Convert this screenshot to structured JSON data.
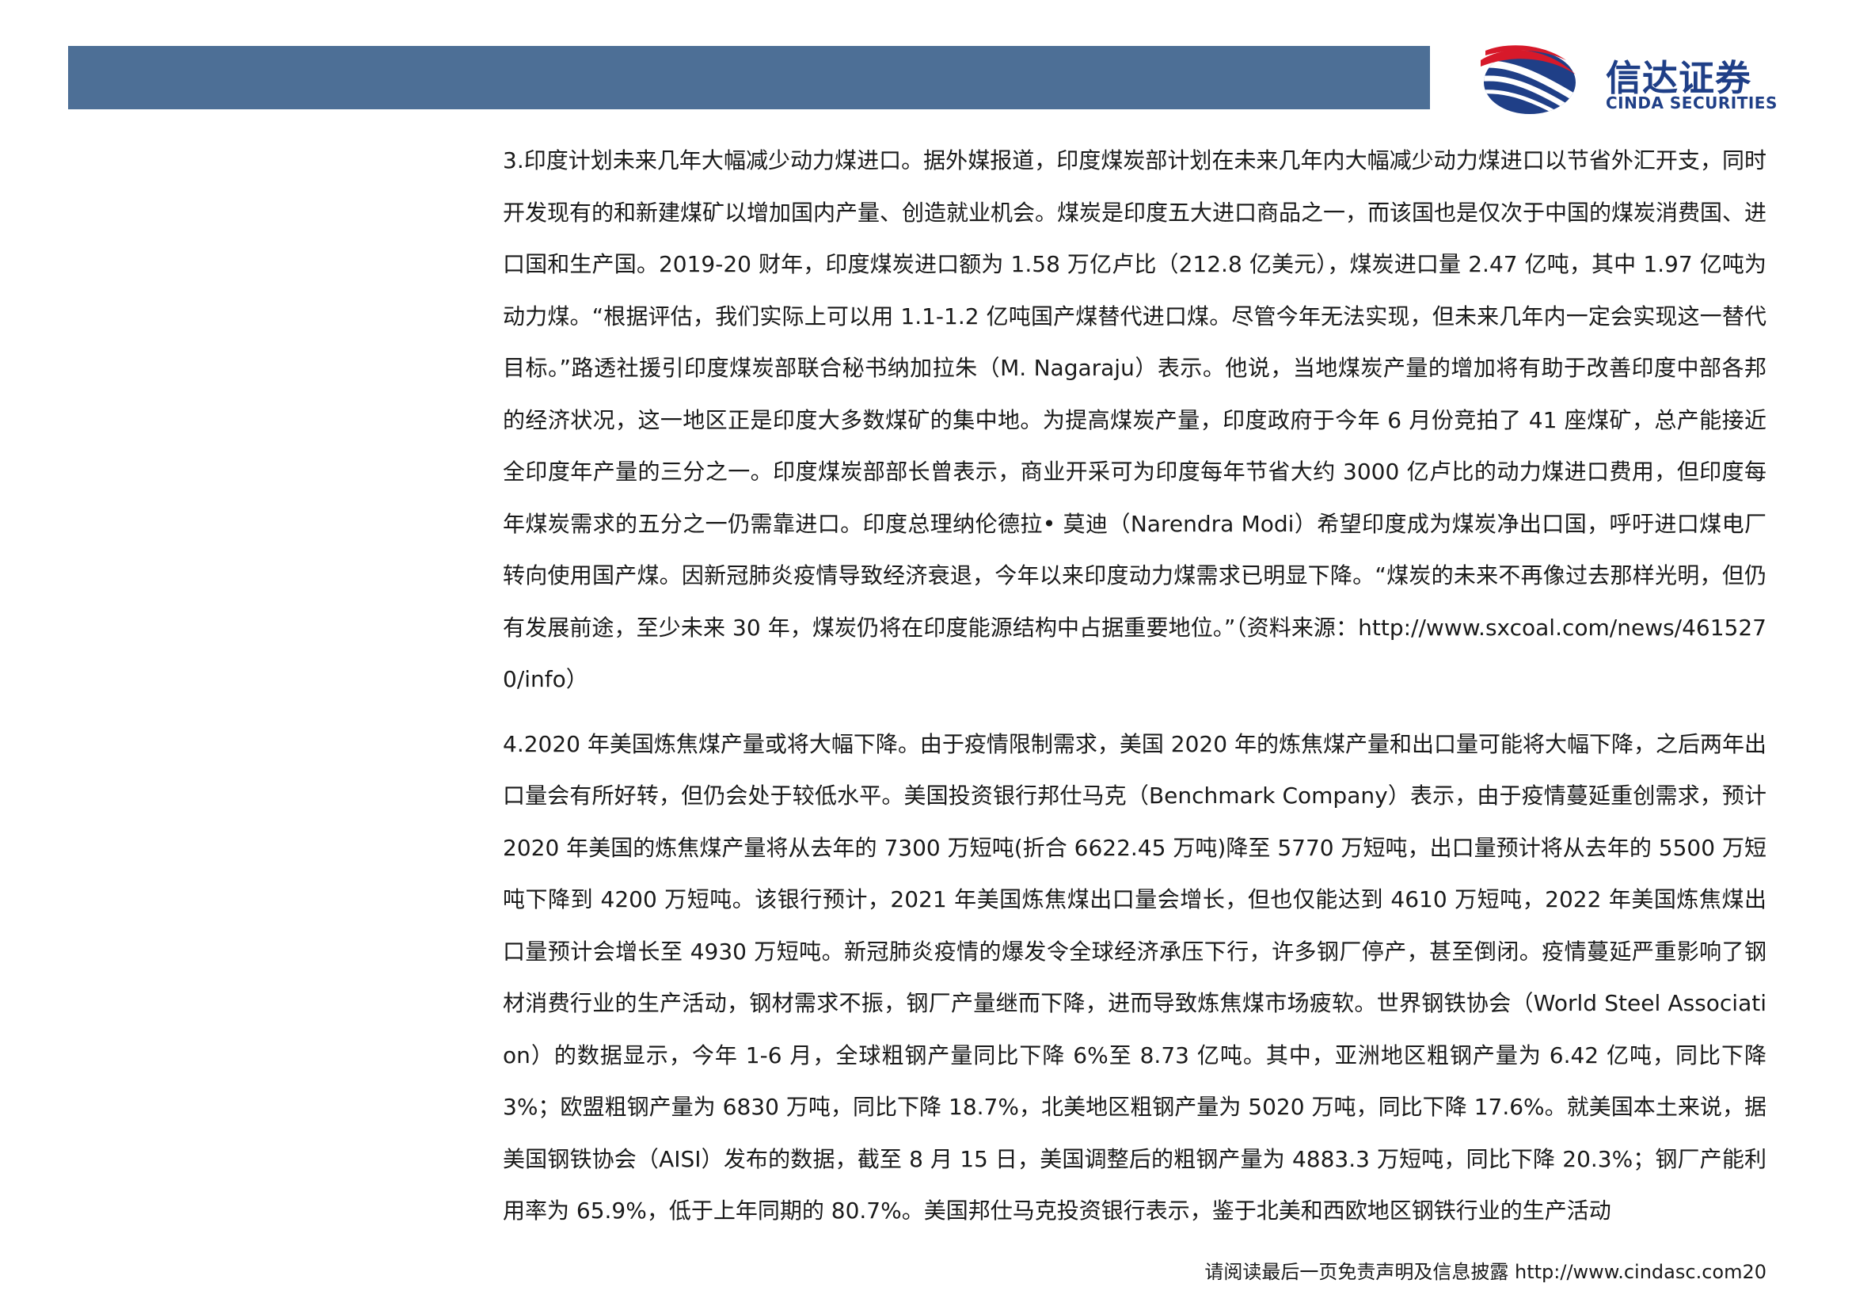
{
  "header": {
    "logo_cn": "信达证券",
    "logo_en": "CINDA SECURITIES",
    "colors": {
      "bar": "#4d6f96",
      "logo_text": "#1f3f87",
      "logo_red": "#d7192a",
      "logo_blue": "#1f3f87"
    },
    "logo_icon": "cinda-swoosh-logo"
  },
  "content": {
    "paragraphs": [
      "3.印度计划未来几年大幅减少动力煤进口。据外媒报道，印度煤炭部计划在未来几年内大幅减少动力煤进口以节省外汇开支，同时开发现有的和新建煤矿以增加国内产量、创造就业机会。煤炭是印度五大进口商品之一，而该国也是仅次于中国的煤炭消费国、进口国和生产国。2019-20 财年，印度煤炭进口额为 1.58 万亿卢比（212.8 亿美元），煤炭进口量 2.47 亿吨，其中 1.97 亿吨为动力煤。“根据评估，我们实际上可以用 1.1-1.2 亿吨国产煤替代进口煤。尽管今年无法实现，但未来几年内一定会实现这一替代目标。”路透社援引印度煤炭部联合秘书纳加拉朱（M. Nagaraju）表示。他说，当地煤炭产量的增加将有助于改善印度中部各邦的经济状况，这一地区正是印度大多数煤矿的集中地。为提高煤炭产量，印度政府于今年 6 月份竞拍了 41 座煤矿，总产能接近全印度年产量的三分之一。印度煤炭部部长曾表示，商业开采可为印度每年节省大约 3000 亿卢比的动力煤进口费用，但印度每年煤炭需求的五分之一仍需靠进口。印度总理纳伦德拉• 莫迪（Narendra Modi）希望印度成为煤炭净出口国，呼吁进口煤电厂转向使用国产煤。因新冠肺炎疫情导致经济衰退，今年以来印度动力煤需求已明显下降。“煤炭的未来不再像过去那样光明，但仍有发展前途，至少未来 30 年，煤炭仍将在印度能源结构中占据重要地位。”（资料来源：http://www.sxcoal.com/news/4615270/info）",
      "4.2020 年美国炼焦煤产量或将大幅下降。由于疫情限制需求，美国 2020 年的炼焦煤产量和出口量可能将大幅下降，之后两年出口量会有所好转，但仍会处于较低水平。美国投资银行邦仕马克（Benchmark Company）表示，由于疫情蔓延重创需求，预计 2020 年美国的炼焦煤产量将从去年的 7300 万短吨(折合 6622.45 万吨)降至 5770 万短吨，出口量预计将从去年的 5500 万短吨下降到 4200 万短吨。该银行预计，2021 年美国炼焦煤出口量会增长，但也仅能达到 4610 万短吨，2022 年美国炼焦煤出口量预计会增长至 4930 万短吨。新冠肺炎疫情的爆发令全球经济承压下行，许多钢厂停产，甚至倒闭。疫情蔓延严重影响了钢材消费行业的生产活动，钢材需求不振，钢厂产量继而下降，进而导致炼焦煤市场疲软。世界钢铁协会（World Steel Association）的数据显示，今年 1-6 月，全球粗钢产量同比下降 6%至 8.73 亿吨。其中，亚洲地区粗钢产量为 6.42 亿吨，同比下降 3%；欧盟粗钢产量为 6830 万吨，同比下降 18.7%，北美地区粗钢产量为 5020 万吨，同比下降 17.6%。就美国本土来说，据美国钢铁协会（AISI）发布的数据，截至 8 月 15 日，美国调整后的粗钢产量为 4883.3 万短吨，同比下降 20.3%；钢厂产能利用率为 65.9%，低于上年同期的 80.7%。美国邦仕马克投资银行表示，鉴于北美和西欧地区钢铁行业的生产活动"
    ]
  },
  "footer": {
    "disclaimer": "请阅读最后一页免责声明及信息披露",
    "website": "http://www.cindasc.com",
    "page_number": "20"
  }
}
